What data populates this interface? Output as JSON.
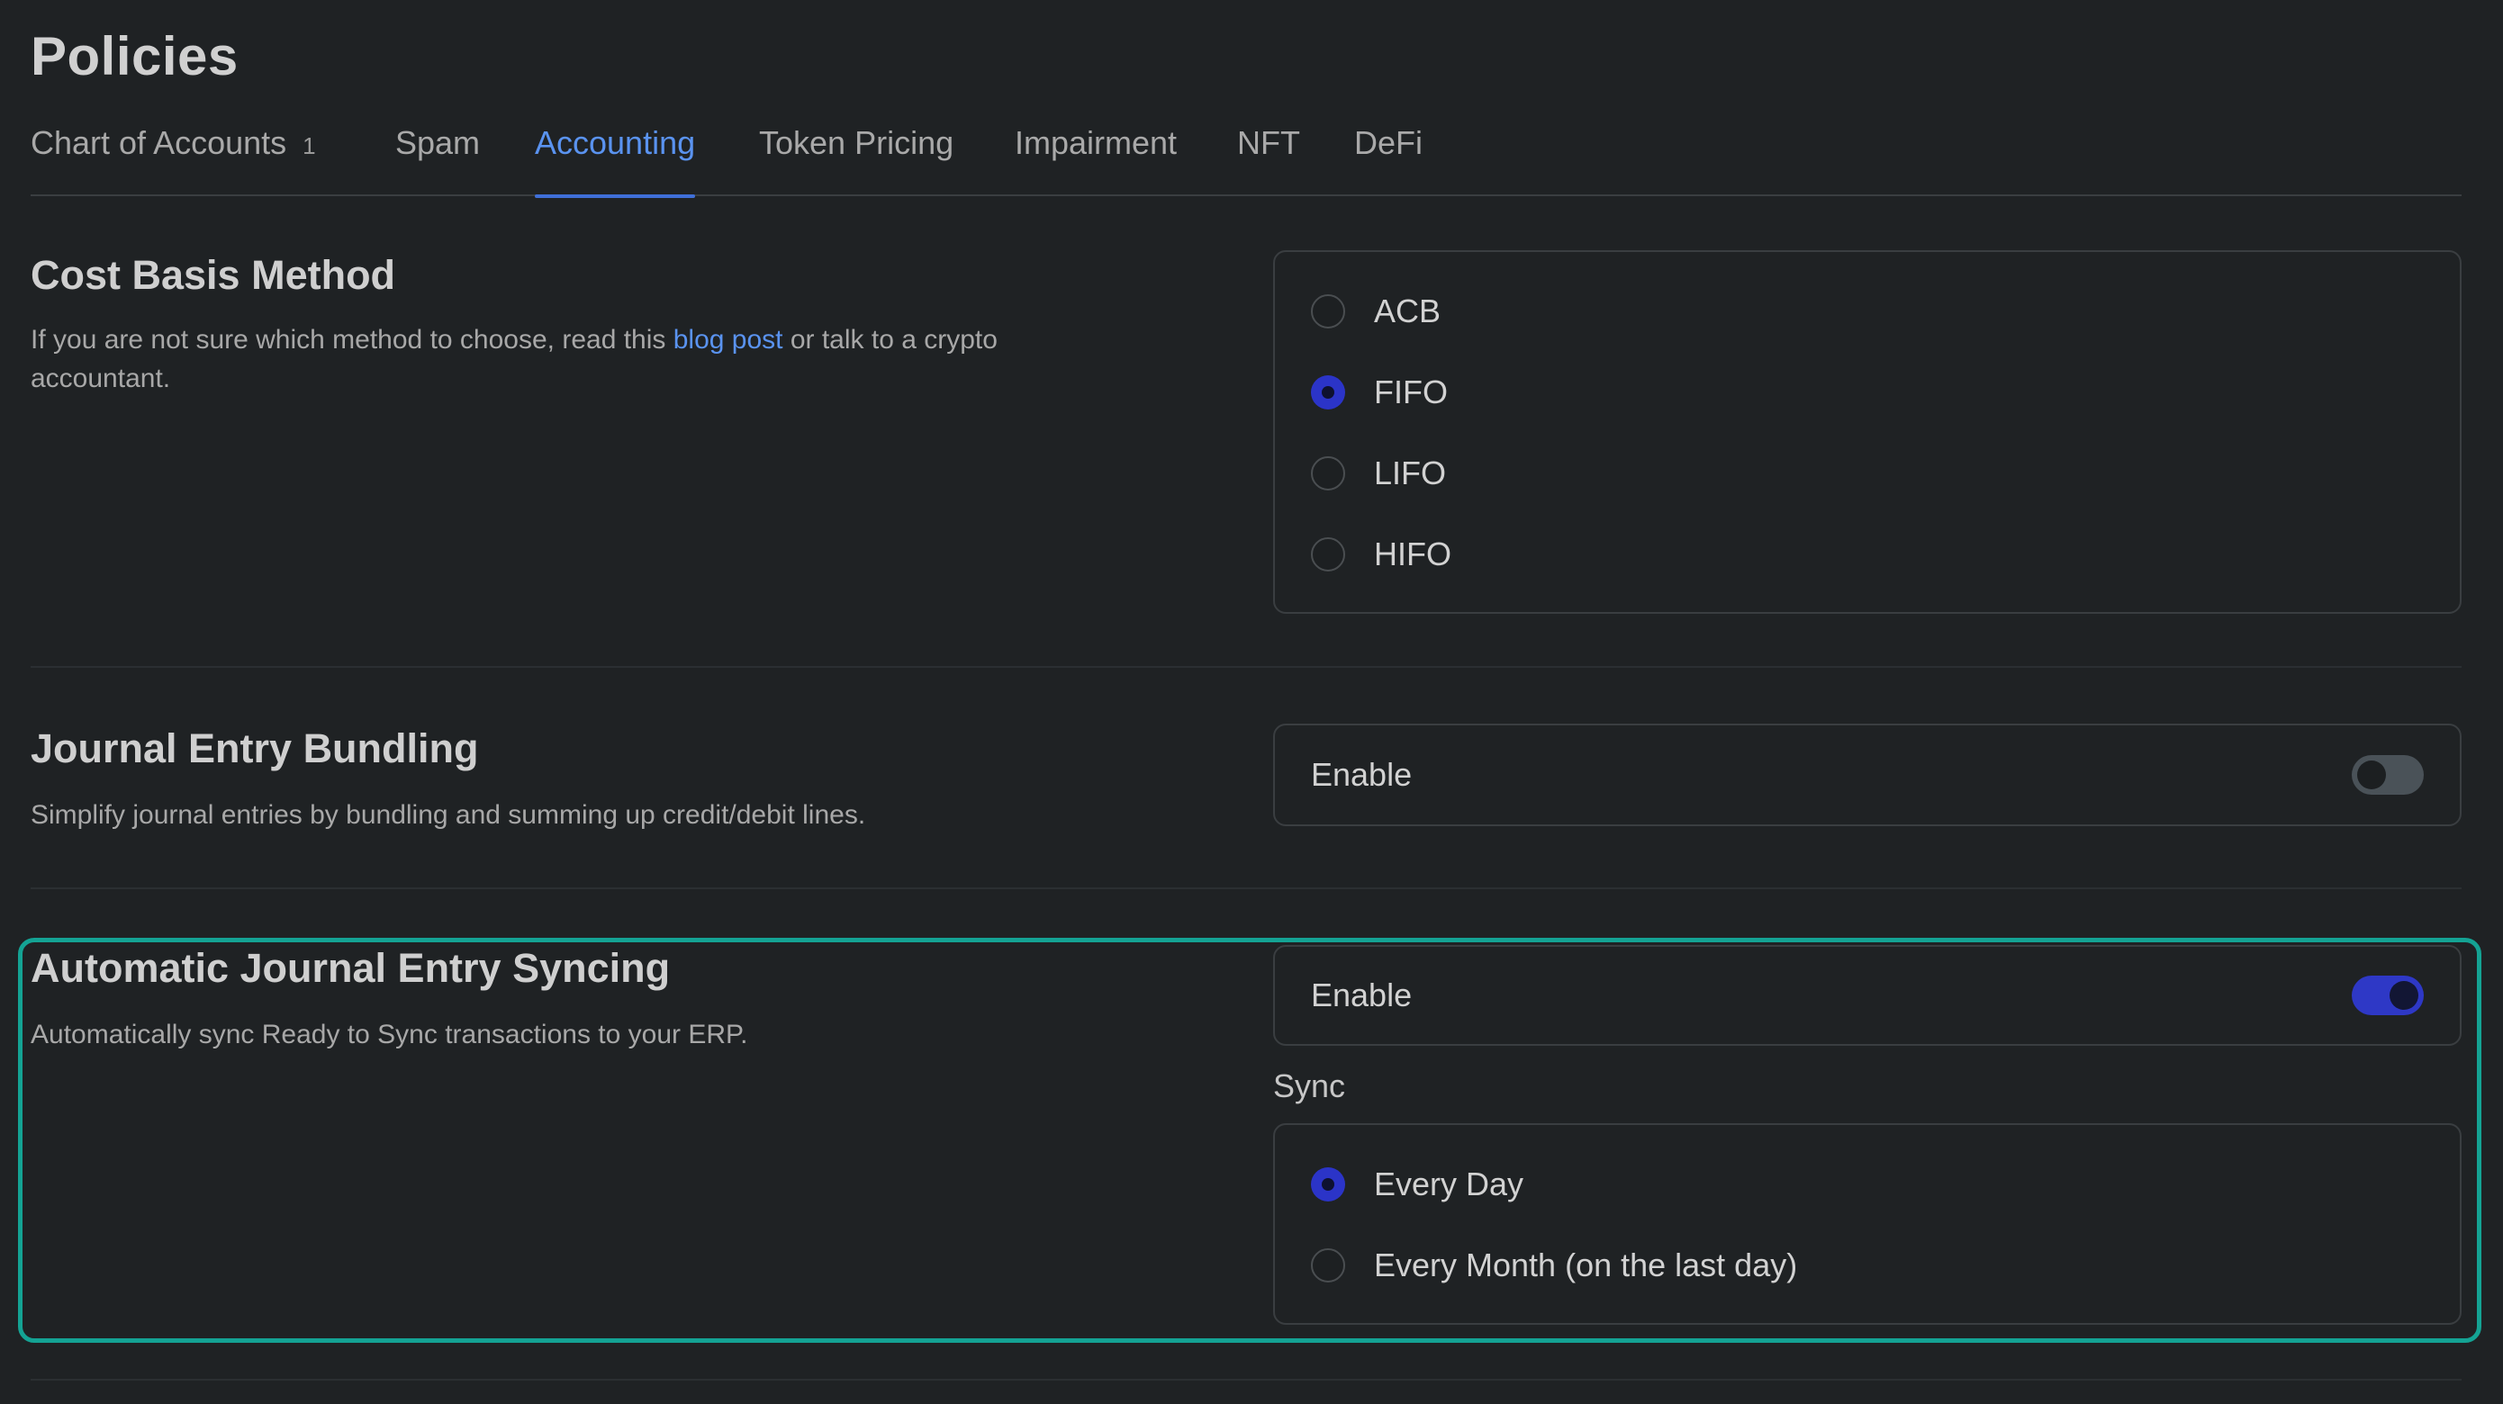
{
  "page": {
    "title": "Policies"
  },
  "tabs": [
    {
      "label": "Chart of Accounts",
      "count": "1"
    },
    {
      "label": "Spam"
    },
    {
      "label": "Accounting"
    },
    {
      "label": "Token Pricing"
    },
    {
      "label": "Impairment"
    },
    {
      "label": "NFT"
    },
    {
      "label": "DeFi"
    }
  ],
  "active_tab": "Accounting",
  "cost_basis": {
    "title": "Cost Basis Method",
    "desc_before": "If you are not sure which method to choose, read this ",
    "link_text": "blog post",
    "desc_after": " or talk to a crypto accountant.",
    "options": [
      "ACB",
      "FIFO",
      "LIFO",
      "HIFO"
    ],
    "selected": "FIFO"
  },
  "bundling": {
    "title": "Journal Entry Bundling",
    "desc": "Simplify journal entries by bundling and summing up credit/debit lines.",
    "toggle_label": "Enable",
    "enabled": false
  },
  "auto_sync": {
    "title": "Automatic Journal Entry Syncing",
    "desc": "Automatically sync Ready to Sync transactions to your ERP.",
    "toggle_label": "Enable",
    "enabled": true,
    "sync_label": "Sync",
    "sync_options": [
      "Every Day",
      "Every Month (on the last day)"
    ],
    "sync_selected": "Every Day"
  },
  "colors": {
    "background": "#1f2224",
    "accent": "#5a93f0",
    "selected": "#2b34c8",
    "highlight": "#14a394"
  }
}
